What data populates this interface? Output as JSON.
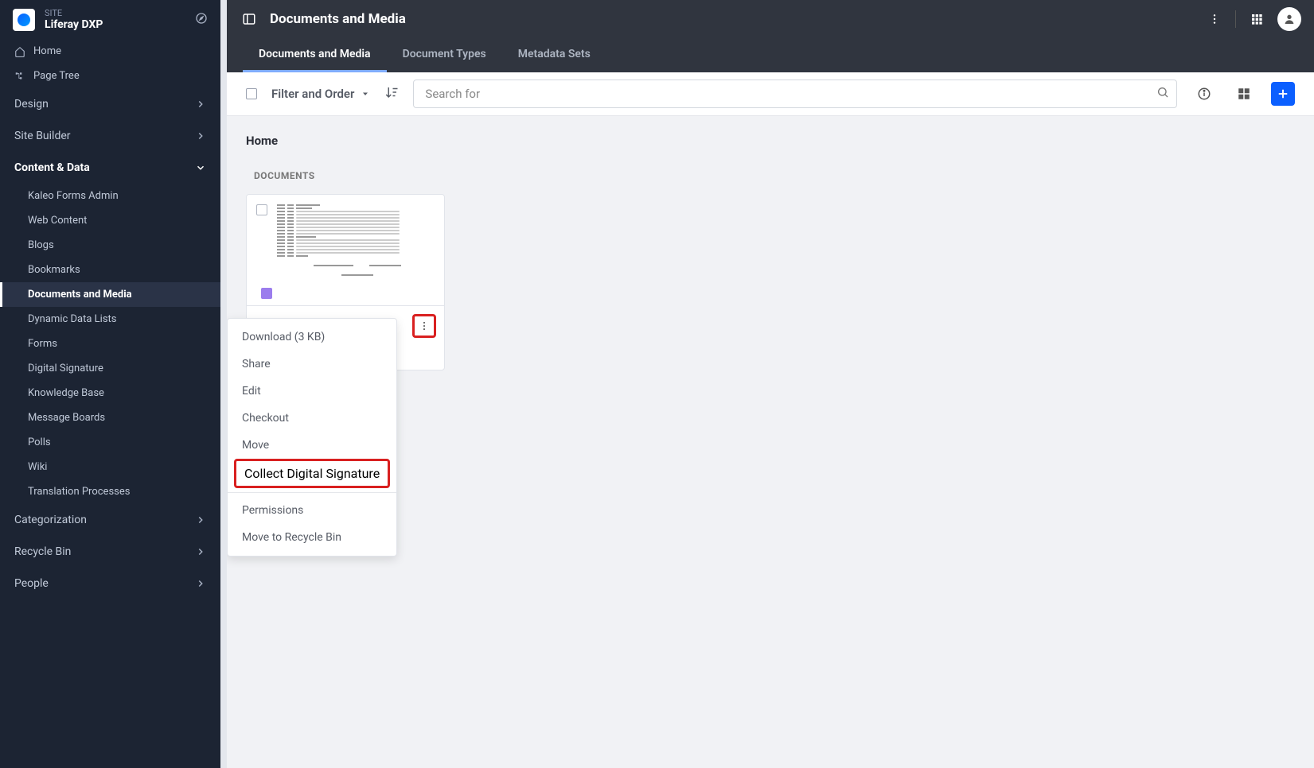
{
  "sidebar": {
    "site_label": "SITE",
    "site_name": "Liferay DXP",
    "home": "Home",
    "page_tree": "Page Tree",
    "sections": {
      "design": "Design",
      "site_builder": "Site Builder",
      "content_data": "Content & Data",
      "categorization": "Categorization",
      "recycle_bin": "Recycle Bin",
      "people": "People"
    },
    "content_items": [
      "Kaleo Forms Admin",
      "Web Content",
      "Blogs",
      "Bookmarks",
      "Documents and Media",
      "Dynamic Data Lists",
      "Forms",
      "Digital Signature",
      "Knowledge Base",
      "Message Boards",
      "Polls",
      "Wiki",
      "Translation Processes"
    ]
  },
  "topbar": {
    "title": "Documents and Media"
  },
  "tabs": [
    "Documents and Media",
    "Document Types",
    "Metadata Sets"
  ],
  "toolbar": {
    "filter_label": "Filter and Order",
    "search_placeholder": "Search for"
  },
  "content": {
    "breadcrumb": "Home",
    "section_label": "DOCUMENTS"
  },
  "context_menu": {
    "download": "Download (3 KB)",
    "share": "Share",
    "edit": "Edit",
    "checkout": "Checkout",
    "move": "Move",
    "collect_signature": "Collect Digital Signature",
    "permissions": "Permissions",
    "move_recycle": "Move to Recycle Bin"
  }
}
